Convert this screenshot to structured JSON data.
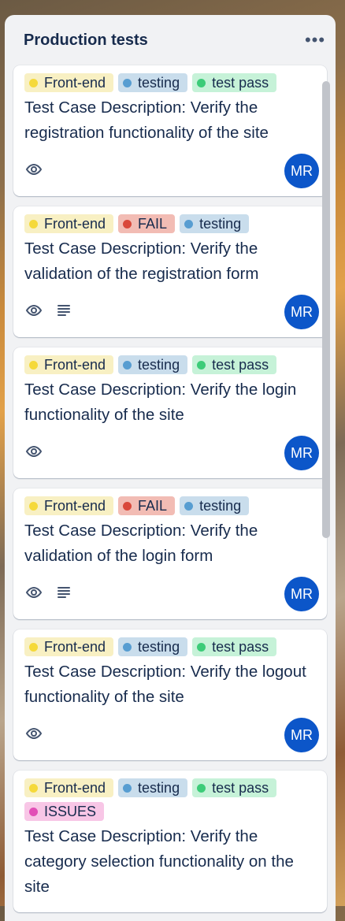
{
  "list": {
    "title": "Production tests",
    "more_label": "•••"
  },
  "label_styles": {
    "front_end": {
      "bg": "#f8f0c3",
      "dot": "#f5d93a"
    },
    "testing": {
      "bg": "#c9ddec",
      "dot": "#579dd1"
    },
    "test_pass": {
      "bg": "#c6f2d8",
      "dot": "#3ccc78"
    },
    "fail": {
      "bg": "#f2bcb4",
      "dot": "#d9483b"
    },
    "issues": {
      "bg": "#f8c6e6",
      "dot": "#e24fb6"
    }
  },
  "cards": [
    {
      "labels": [
        "Front-end",
        "testing",
        "test pass"
      ],
      "title": "Test Case Description: Verify the registration functionality of the site",
      "has_description": false,
      "avatar": "MR"
    },
    {
      "labels": [
        "Front-end",
        "FAIL",
        "testing"
      ],
      "title": "Test Case Description: Verify the validation of the registration form",
      "has_description": true,
      "avatar": "MR"
    },
    {
      "labels": [
        "Front-end",
        "testing",
        "test pass"
      ],
      "title": "Test Case Description: Verify the login functionality of the site",
      "has_description": false,
      "avatar": "MR"
    },
    {
      "labels": [
        "Front-end",
        "FAIL",
        "testing"
      ],
      "title": "Test Case Description: Verify the validation of the login form",
      "has_description": true,
      "avatar": "MR"
    },
    {
      "labels": [
        "Front-end",
        "testing",
        "test pass"
      ],
      "title": "Test Case Description: Verify the logout functionality of the site",
      "has_description": false,
      "avatar": "MR"
    },
    {
      "labels": [
        "Front-end",
        "testing",
        "test pass",
        "ISSUES"
      ],
      "title": "Test Case Description: Verify the category selection functionality on the site",
      "has_description": false,
      "avatar": ""
    }
  ]
}
